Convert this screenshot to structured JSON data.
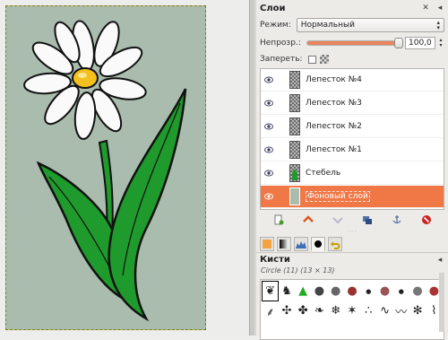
{
  "layers_panel": {
    "title": "Слои",
    "mode_label": "Режим:",
    "mode_value": "Нормальный",
    "opacity_label": "Непрозр.:",
    "opacity_value": "100,0",
    "opacity_fraction": 1.0,
    "lock_label": "Запереть:",
    "layers": [
      {
        "name": "Лепесток №4",
        "thumb": "checker",
        "visible": true,
        "active": false
      },
      {
        "name": "Лепесток №3",
        "thumb": "checker",
        "visible": true,
        "active": false
      },
      {
        "name": "Лепесток №2",
        "thumb": "checker",
        "visible": true,
        "active": false
      },
      {
        "name": "Лепесток №1",
        "thumb": "checker",
        "visible": true,
        "active": false
      },
      {
        "name": "Стебель",
        "thumb": "stem",
        "visible": true,
        "active": false
      },
      {
        "name": "Фоновый слой",
        "thumb": "bg",
        "visible": true,
        "active": true
      }
    ],
    "buttons": [
      "new-layer-icon",
      "raise-layer-icon",
      "lower-layer-icon",
      "duplicate-layer-icon",
      "anchor-layer-icon",
      "delete-layer-icon"
    ]
  },
  "brushes_panel": {
    "title": "Кисти",
    "subtitle": "Circle (11) (13 × 13)",
    "tabs": [
      "colors-tab-icon",
      "gradient-tab-icon",
      "histogram-tab-icon",
      "brush-tab-icon",
      "undo-tab-icon"
    ],
    "active_tab": 3
  },
  "colors": {
    "canvas_bg": "#a9bcae",
    "active_layer": "#f07746",
    "stem_green": "#1f9a2c",
    "flower_center": "#f4c01e"
  }
}
